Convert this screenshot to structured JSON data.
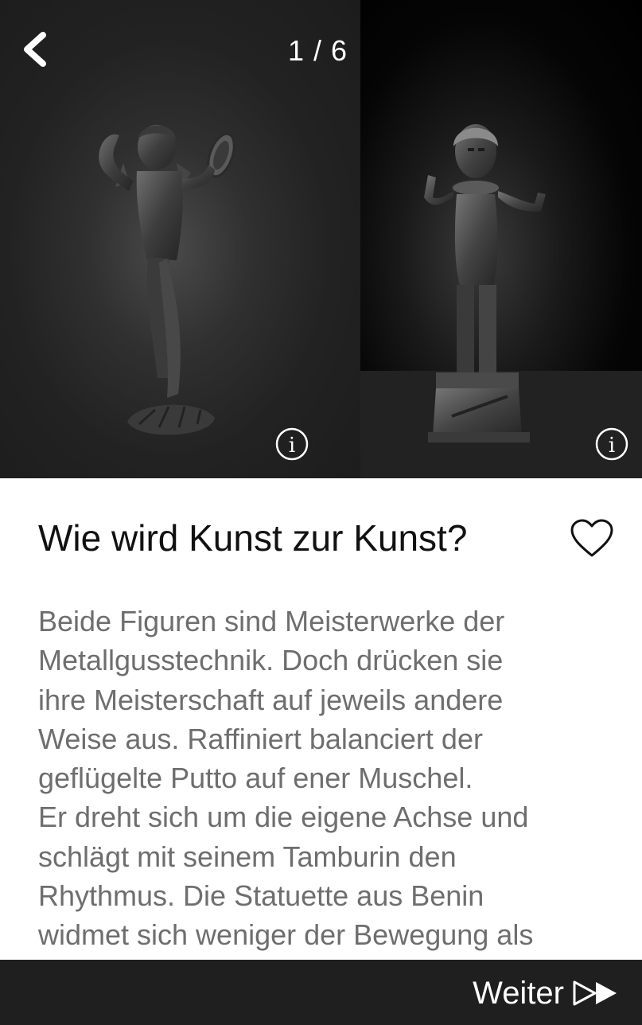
{
  "header": {
    "counter": "1 / 6",
    "back_icon": "chevron-left-icon"
  },
  "gallery": {
    "left_figure": "putto-statuette",
    "right_figure": "benin-statuette",
    "info_icon": "info-icon"
  },
  "content": {
    "title": "Wie wird Kunst zur Kunst?",
    "favorite_icon": "heart-outline-icon",
    "lines": [
      "Beide Figuren sind Meisterwerke der",
      "Metallgusstechnik. Doch drücken sie",
      "ihre Meisterschaft auf jeweils andere",
      "Weise aus. Raffiniert balanciert der",
      "geflügelte Putto auf ener Muschel.",
      "Er dreht sich um die eigene Achse und",
      "schlägt mit seinem Tamburin den",
      "Rhythmus. Die Statuette aus Benin",
      "widmet sich weniger der Bewegung als"
    ]
  },
  "footer": {
    "next_label": "Weiter",
    "next_icon": "fast-forward-icon"
  },
  "colors": {
    "dark_background": "#1f1f1f",
    "text_primary": "#111111",
    "text_secondary": "#6e6e6e",
    "on_dark": "#ffffff"
  }
}
